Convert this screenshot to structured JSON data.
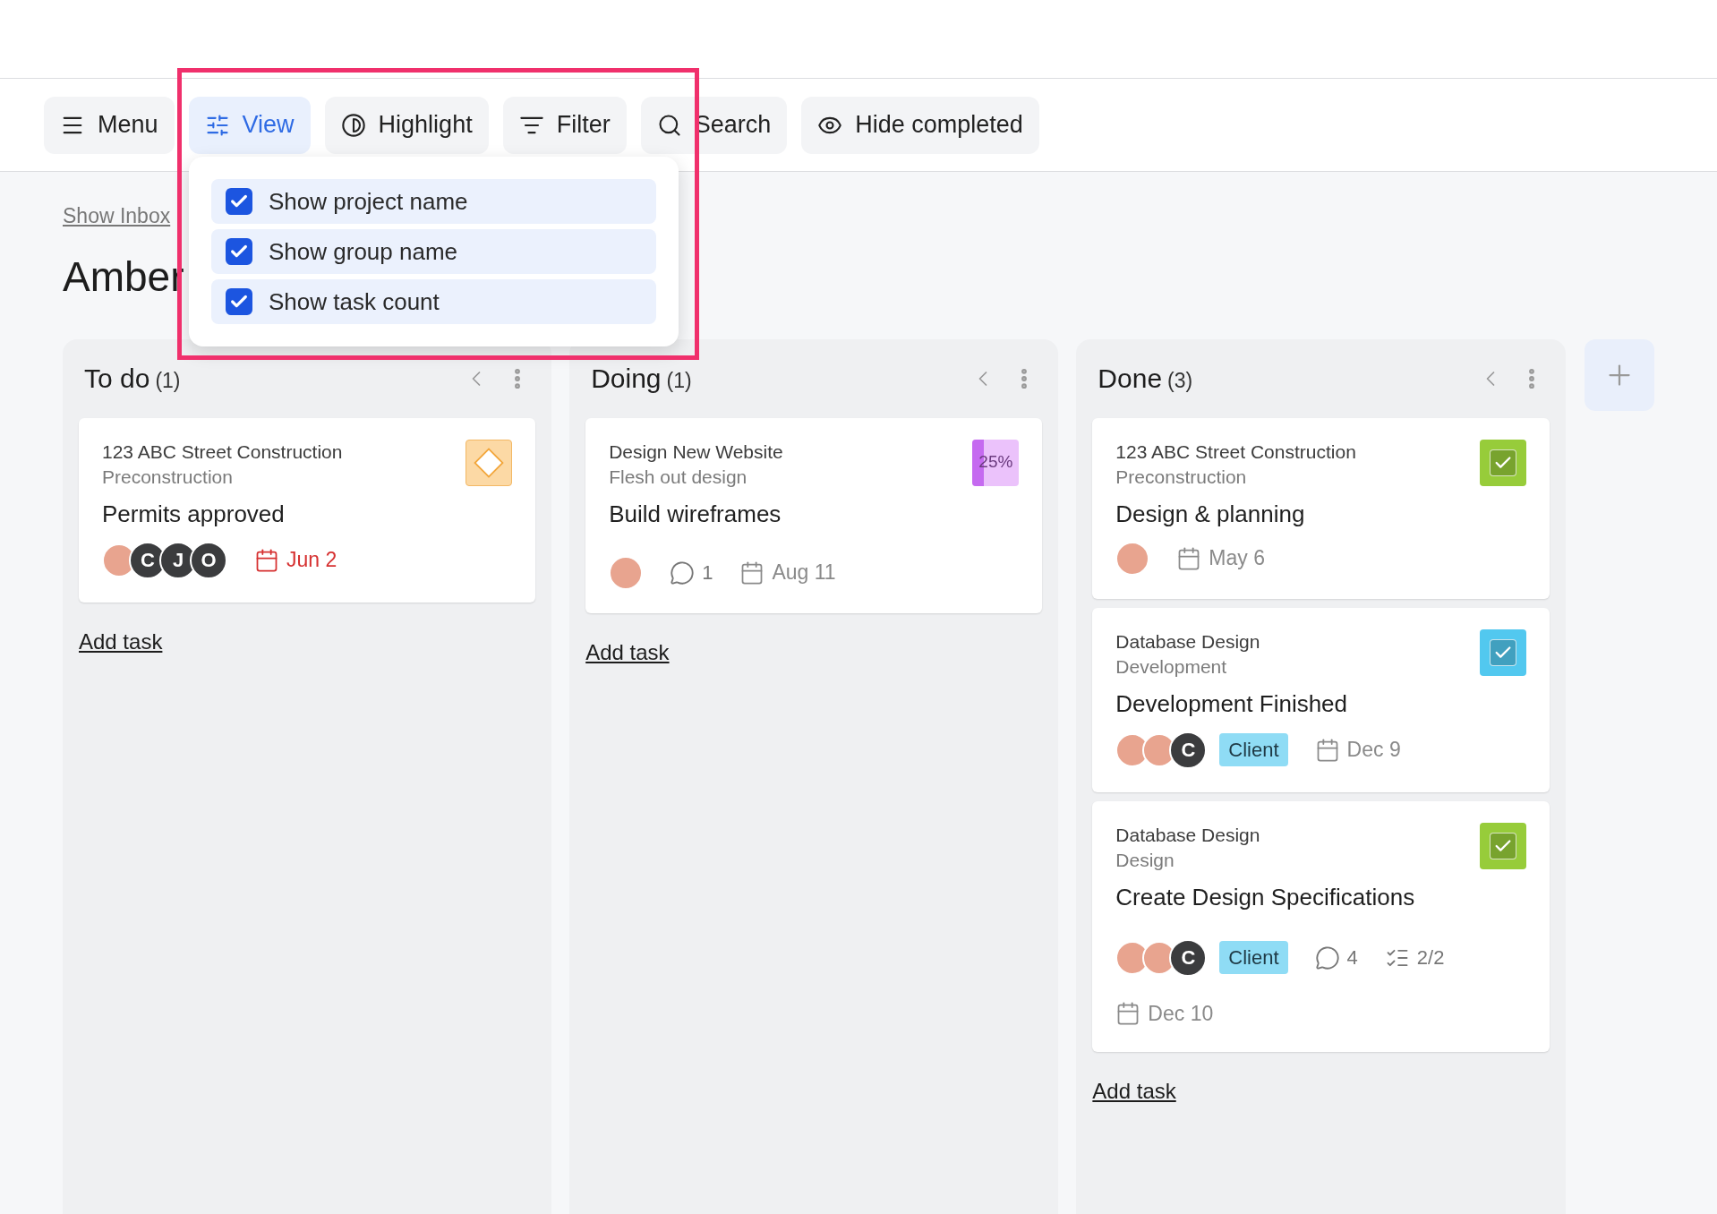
{
  "toolbar": {
    "buttons": [
      {
        "kind": "menu",
        "label": "Menu",
        "selected": false
      },
      {
        "kind": "view",
        "label": "View",
        "selected": true
      },
      {
        "kind": "highlight",
        "label": "Highlight",
        "selected": false
      },
      {
        "kind": "filter",
        "label": "Filter",
        "selected": false
      },
      {
        "kind": "search",
        "label": "Search",
        "selected": false
      },
      {
        "kind": "hide",
        "label": "Hide completed",
        "selected": false
      }
    ]
  },
  "view_menu": {
    "options": [
      {
        "label": "Show project name",
        "checked": true
      },
      {
        "label": "Show group name",
        "checked": true
      },
      {
        "label": "Show task count",
        "checked": true
      }
    ]
  },
  "show_inbox": "Show Inbox",
  "board_title": "Amber",
  "columns": [
    {
      "title": "To do",
      "count": "(1)",
      "add_label": "Add task",
      "cards": [
        {
          "project": "123 ABC Street Construction",
          "group": "Preconstruction",
          "title": "Permits approved",
          "status": {
            "kind": "milestone"
          },
          "assignees": [
            {
              "kind": "photo"
            },
            {
              "kind": "initial",
              "letter": "C"
            },
            {
              "kind": "initial",
              "letter": "J"
            },
            {
              "kind": "initial",
              "letter": "O"
            }
          ],
          "due": {
            "label": "Jun 2",
            "overdue": true
          }
        }
      ]
    },
    {
      "title": "Doing",
      "count": "(1)",
      "add_label": "Add task",
      "cards": [
        {
          "project": "Design New Website",
          "group": "Flesh out design",
          "title": "Build wireframes",
          "status": {
            "kind": "progress",
            "level": 0.25,
            "label": "25%"
          },
          "assignees": [
            {
              "kind": "photo"
            }
          ],
          "comments": "1",
          "due": {
            "label": "Aug 11",
            "overdue": false
          }
        }
      ]
    },
    {
      "title": "Done",
      "count": "(3)",
      "add_label": "Add task",
      "cards": [
        {
          "project": "123 ABC Street Construction",
          "group": "Preconstruction",
          "title": "Design & planning",
          "status": {
            "kind": "done",
            "color": "#97cc3a"
          },
          "assignees": [
            {
              "kind": "photo"
            }
          ],
          "due": {
            "label": "May 6",
            "overdue": false
          }
        },
        {
          "project": "Database Design",
          "group": "Development",
          "title": "Development Finished",
          "status": {
            "kind": "done",
            "color": "#52c8ef"
          },
          "assignees": [
            {
              "kind": "photo"
            },
            {
              "kind": "photo"
            },
            {
              "kind": "initial",
              "letter": "C"
            }
          ],
          "tags": [
            {
              "label": "Client",
              "color": "#8fdcf5"
            }
          ],
          "due": {
            "label": "Dec 9",
            "overdue": false
          }
        },
        {
          "project": "Database Design",
          "group": "Design",
          "title": "Create Design Specifications",
          "status": {
            "kind": "done",
            "color": "#97cc3a"
          },
          "assignees": [
            {
              "kind": "photo"
            },
            {
              "kind": "photo"
            },
            {
              "kind": "initial",
              "letter": "C"
            }
          ],
          "tags": [
            {
              "label": "Client",
              "color": "#8fdcf5"
            }
          ],
          "comments": "4",
          "checklist": "2/2",
          "due": {
            "label": "Dec 10",
            "overdue": false
          }
        }
      ]
    }
  ]
}
